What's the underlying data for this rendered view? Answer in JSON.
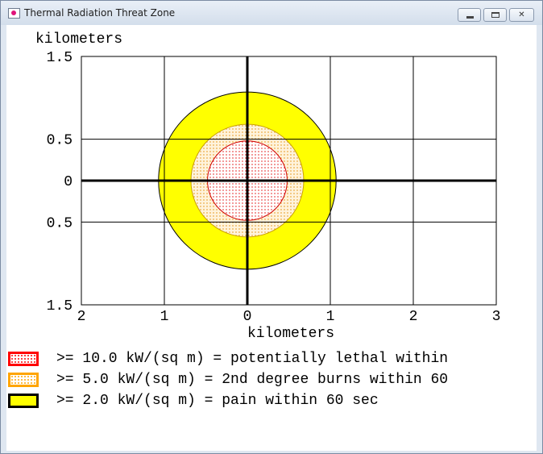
{
  "window": {
    "title": "Thermal Radiation Threat Zone"
  },
  "controls": {
    "minimize": "minimize",
    "maximize": "maximize",
    "close": "close"
  },
  "chart_data": {
    "type": "area",
    "xlabel": "kilometers",
    "ylabel": "kilometers",
    "xlim": [
      -2,
      3
    ],
    "ylim": [
      -1.5,
      1.5
    ],
    "x_ticks": [
      "2",
      "1",
      "0",
      "1",
      "2",
      "3"
    ],
    "y_ticks": [
      "1.5",
      "0.5",
      "0",
      "0.5",
      "1.5"
    ],
    "grid": true,
    "zones": [
      {
        "name": ">= 2.0 kW/(sq m)",
        "radius_km": 1.07,
        "center": [
          0,
          0
        ],
        "color": "#ffff00",
        "pattern": "solid"
      },
      {
        "name": ">= 5.0 kW/(sq m)",
        "radius_km": 0.68,
        "center": [
          0,
          0
        ],
        "color": "#ffa500",
        "pattern": "dots"
      },
      {
        "name": ">= 10.0 kW/(sq m)",
        "radius_km": 0.48,
        "center": [
          0,
          0
        ],
        "color": "#ff0000",
        "pattern": "dots"
      }
    ]
  },
  "legend": [
    {
      "text": ">= 10.0 kW/(sq m) = potentially lethal within",
      "border": "#ff0000",
      "fill": "#ffffff",
      "dot": "#ff0000"
    },
    {
      "text": ">= 5.0 kW/(sq m) = 2nd degree burns within 60",
      "border": "#ffa500",
      "fill": "#ffffff",
      "dot": "#ffa500"
    },
    {
      "text": ">= 2.0 kW/(sq m) = pain within 60 sec",
      "border": "#000000",
      "fill": "#ffff00",
      "dot": ""
    }
  ]
}
